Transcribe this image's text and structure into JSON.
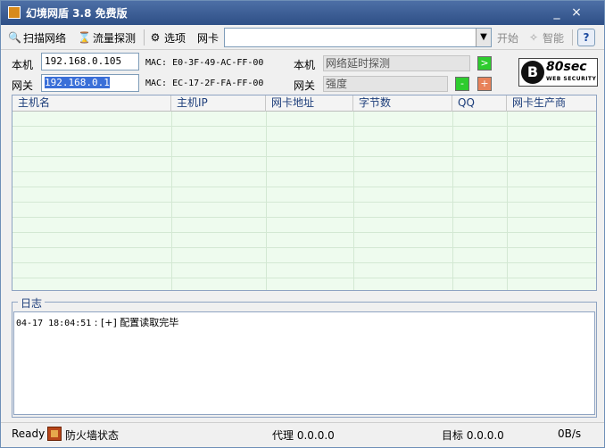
{
  "app": {
    "title": "幻境网盾 3.8 免费版"
  },
  "window_controls": {
    "minimize": "_",
    "close": "×"
  },
  "toolbar": {
    "scan": "扫描网络",
    "traffic": "流量探测",
    "options": "选项",
    "nic_label": "网卡",
    "nic_value": "",
    "start": "开始",
    "smart": "智能",
    "help": "?"
  },
  "local": {
    "label": "本机",
    "ip": "192.168.0.105",
    "mac": "MAC: E0-3F-49-AC-FF-00",
    "probe_label": "本机",
    "probe_text": "网络延时探测",
    "go_btn": ">"
  },
  "gateway": {
    "label": "网关",
    "ip": "192.168.0.1",
    "mac": "MAC: EC-17-2F-FA-FF-00",
    "probe_label": "网关",
    "probe_text": "强度",
    "minus_btn": "-",
    "plus_btn": "+"
  },
  "logo": {
    "mark": "B",
    "text": "80sec",
    "sub": "WEB SECURITY"
  },
  "table": {
    "columns": [
      "主机名",
      "主机IP",
      "网卡地址",
      "字节数",
      "QQ",
      "网卡生产商"
    ],
    "rows": []
  },
  "log": {
    "title": "日志",
    "entries": [
      {
        "time": "04-17 18:04:51",
        "text": " : [+] 配置读取完毕"
      }
    ]
  },
  "status": {
    "ready": "Ready",
    "firewall": "防火墙状态",
    "proxy": "代理 0.0.0.0",
    "target": "目标 0.0.0.0",
    "speed": "0B/s"
  },
  "colors": {
    "titlebar": "#2e4f86",
    "go_btn": "#2ecc2e",
    "plus_btn": "#e8825a",
    "table_bg": "#eefbee"
  }
}
